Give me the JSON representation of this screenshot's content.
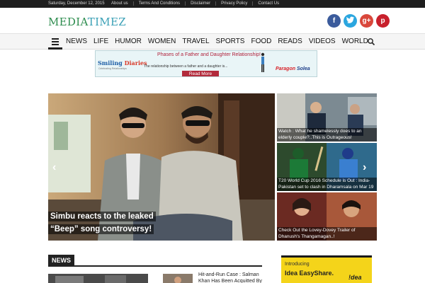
{
  "topbar": {
    "date": "Saturday, December 12, 2015",
    "links": [
      "About us",
      "Terms And Conditions",
      "Disclaimer",
      "Privacy Policy",
      "Contact Us"
    ]
  },
  "logo": {
    "part1": "MEDIA",
    "part2": "TIMEZ"
  },
  "social": [
    {
      "name": "facebook",
      "glyph": "f",
      "color": "#3b5b9c"
    },
    {
      "name": "twitter",
      "glyph": "t",
      "color": "#2ba6df"
    },
    {
      "name": "google-plus",
      "glyph": "g+",
      "color": "#d9473b"
    },
    {
      "name": "pinterest",
      "glyph": "p",
      "color": "#c8202c"
    }
  ],
  "nav": {
    "items": [
      "NEWS",
      "LIFE",
      "HUMOR",
      "WOMEN",
      "TRAVEL",
      "SPORTS",
      "FOOD",
      "READS",
      "VIDEOS",
      "WORLD"
    ],
    "menu_icon": "hamburger-icon",
    "search_icon": "search-icon"
  },
  "ad_banner": {
    "brand_part1": "Smiling ",
    "brand_part2": "Diaries",
    "brand_sub": "Celebrating Relationships",
    "headline": "Phases of a Father and Daughter Relationship!",
    "body": "The relationship between a father and a daughter is...",
    "button": "Read More",
    "sponsor_part1": "Paragon",
    "sponsor_part2": "Solea"
  },
  "hero": {
    "title_line1": "Simbu reacts to the leaked",
    "title_line2": "“Beep” song controversy!",
    "prev_icon": "chevron-left-icon",
    "next_icon": "chevron-right-icon"
  },
  "side_tiles": [
    {
      "caption": "Watch : What he shamelessly does to an elderly couple?..This is Outrageous!"
    },
    {
      "caption": "T20 World Cup 2016 Schedule is Out : India-Pakistan set to clash in Dharamsala on Mar 19"
    },
    {
      "caption": "Check Out the Lovey-Dovey Trailer of Dhanush's Thangamagan..!"
    }
  ],
  "news_section": {
    "heading": "NEWS",
    "item_title": "Hit-and-Run Case : Salman Khan Has Been Acquitted By"
  },
  "side_ad": {
    "intro": "Introducing",
    "main": "Idea EasyShare.",
    "logo": "!dea"
  },
  "colors": {
    "topbar": "#1e1e1e",
    "logo_green": "#2d8c4e",
    "logo_teal": "#3aa0b6",
    "ad_button": "#b22b3c",
    "idea_yellow": "#f4d41a"
  }
}
